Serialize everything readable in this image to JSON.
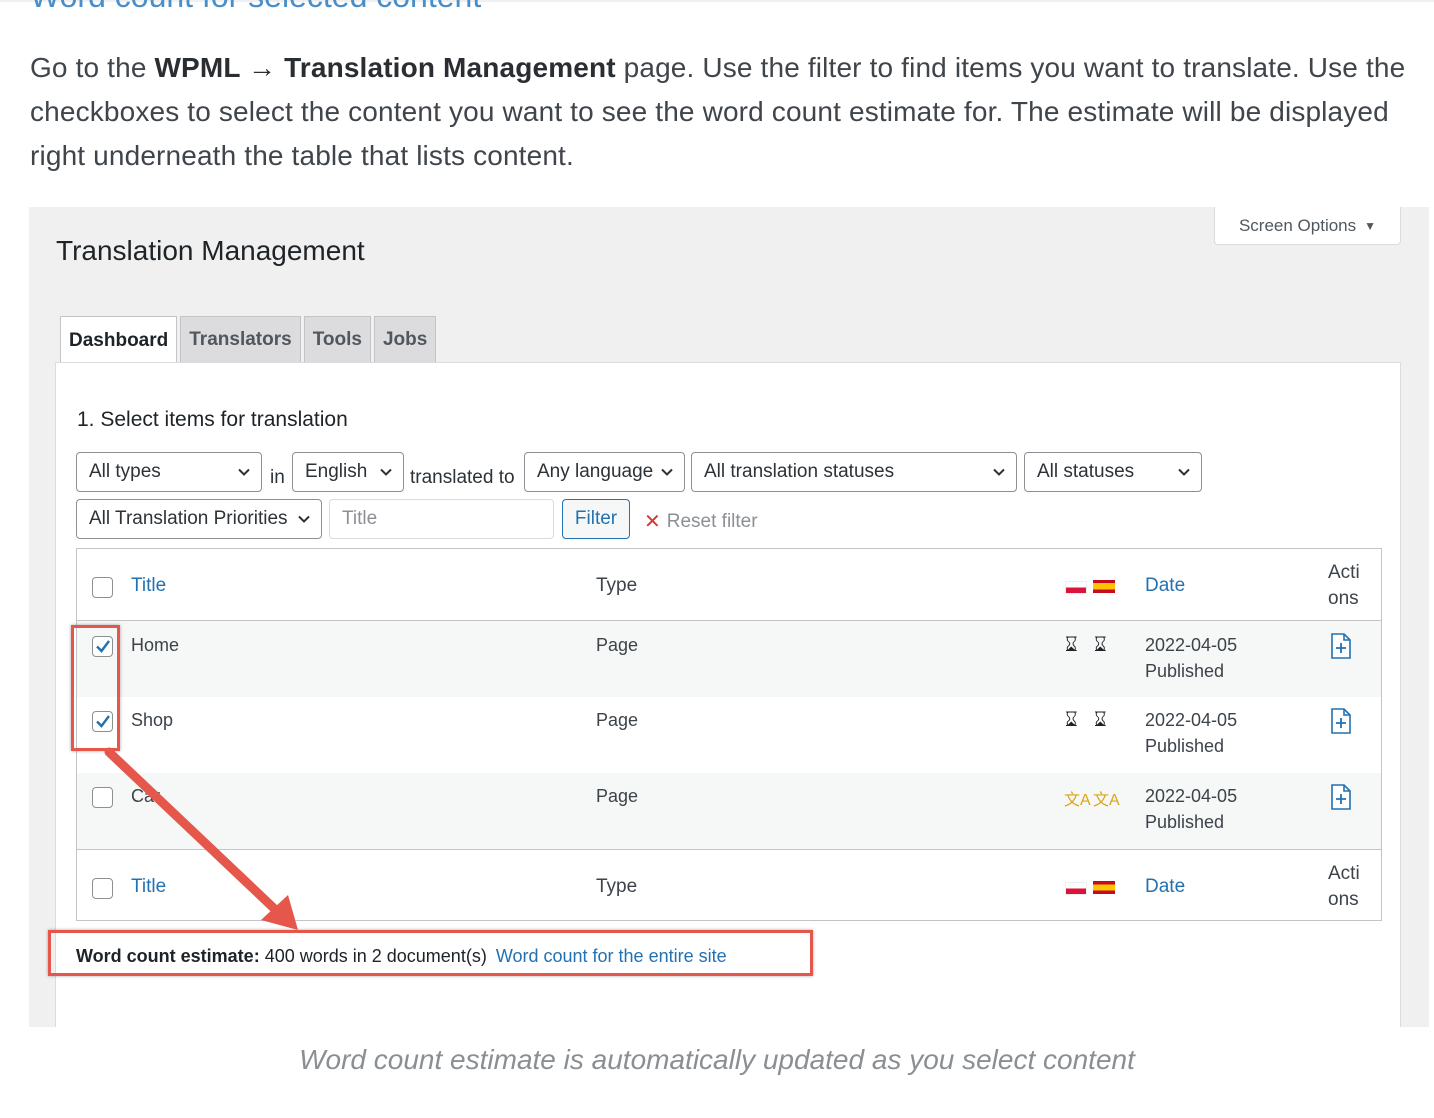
{
  "article": {
    "cut_heading": "Word count for selected content",
    "intro": {
      "prefix": "Go to the ",
      "bold_path": "WPML → Translation Management",
      "suffix": " page. Use the filter to find items you want to translate. Use the checkboxes to select the content you want to see the word count estimate for. The estimate will be displayed right underneath the table that lists content."
    },
    "caption": "Word count estimate is automatically updated as you select content"
  },
  "wp": {
    "screen_options": "Screen Options",
    "page_title": "Translation Management",
    "tabs": [
      {
        "label": "Dashboard",
        "active": true
      },
      {
        "label": "Translators"
      },
      {
        "label": "Tools"
      },
      {
        "label": "Jobs"
      }
    ],
    "section_title": "1. Select items for translation",
    "filters": {
      "type": "All types",
      "in_label": "in",
      "language": "English",
      "translated_to_label": "translated to",
      "target_language": "Any language",
      "translation_status": "All translation statuses",
      "status": "All statuses",
      "priority": "All Translation Priorities",
      "title_placeholder": "Title",
      "filter_button": "Filter",
      "reset_filter": "Reset filter"
    },
    "table": {
      "headers": {
        "title": "Title",
        "type": "Type",
        "date": "Date",
        "actions_1": "Acti",
        "actions_2": "ons"
      },
      "rows": [
        {
          "title": "Home",
          "type": "Page",
          "date": "2022-04-05",
          "status": "Published",
          "checked": true,
          "lang_status": "in-progress"
        },
        {
          "title": "Shop",
          "type": "Page",
          "date": "2022-04-05",
          "status": "Published",
          "checked": true,
          "lang_status": "in-progress"
        },
        {
          "title": "Car",
          "type": "Page",
          "date": "2022-04-05",
          "status": "Published",
          "checked": false,
          "lang_status": "needs-translation"
        }
      ]
    },
    "word_count": {
      "label": "Word count estimate:",
      "value": "400 words in 2 document(s)",
      "link": "Word count for the entire site"
    }
  },
  "icons": {
    "in_progress": "hourglass-icon",
    "needs_translation": "translate-icon",
    "action": "add-document-icon"
  },
  "colors": {
    "link": "#2271b1",
    "highlight": "#e4574a",
    "orange_icon": "#dba617"
  }
}
